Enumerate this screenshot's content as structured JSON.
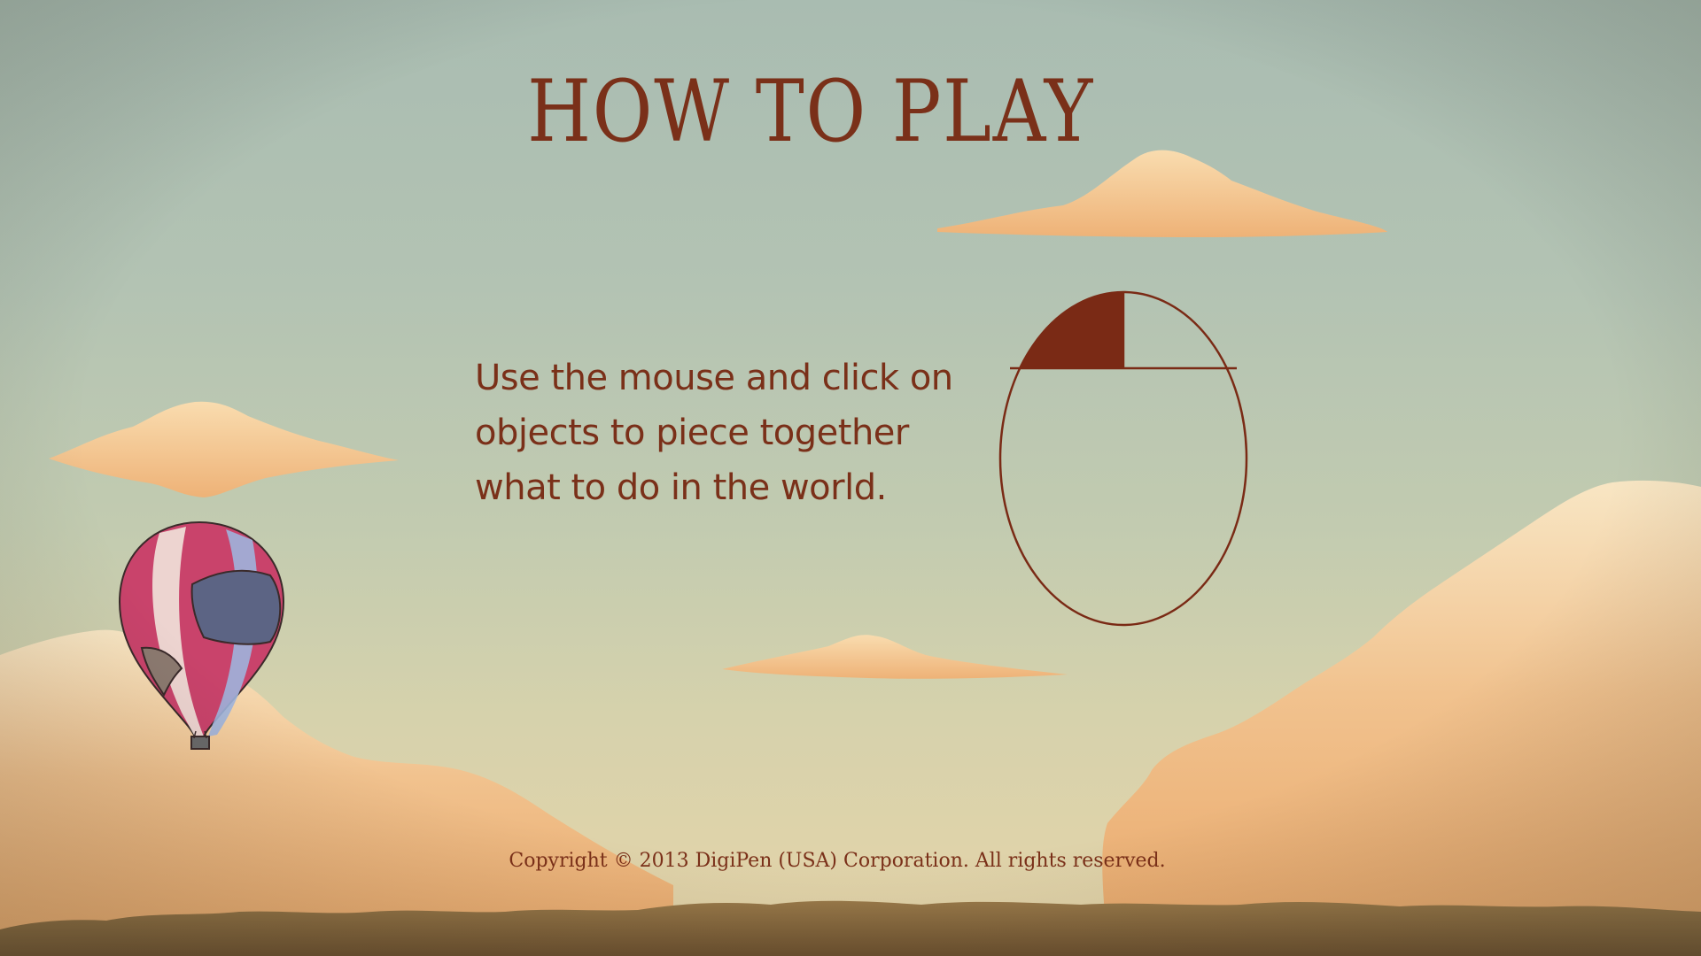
{
  "screen": {
    "title": "HOW TO PLAY",
    "instruction": "Use the mouse and click on objects to piece together what to do in the world.",
    "copyright": "Copyright © 2013 DigiPen (USA) Corporation. All rights reserved."
  },
  "illustration": {
    "mouse_icon": "mouse-left-click-icon",
    "balloon_icon": "hot-air-balloon-icon",
    "active_button": "left"
  },
  "colors": {
    "text": "#7a3019",
    "mouse_outline": "#7a3019",
    "mouse_button_fill": "#7a2a15",
    "cloud": "#f3bf86",
    "ground": "#8a6a3e"
  }
}
